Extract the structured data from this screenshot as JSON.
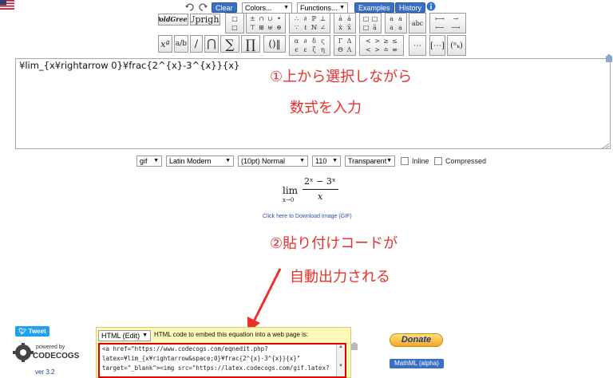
{
  "toolbar": {
    "clear_label": "Clear",
    "colors_select": "Colors...",
    "functions_select": "Functions...",
    "examples_label": "Examples",
    "history_label": "History",
    "boldgreek_label": "𝐁oldGreek",
    "upright_label": "Upright"
  },
  "editor": {
    "content": "¥lim_{x¥rightarrow 0}¥frac{2^{x}-3^{x}}{x}"
  },
  "annotations": {
    "step1_line1": "①上から選択しながら",
    "step1_line2": "数式を入力",
    "step2_line1": "②貼り付けコードが",
    "step2_line2": "自動出力される"
  },
  "options": {
    "format": "gif",
    "font": "Latin Modern",
    "size": "(10pt) Normal",
    "dpi": "110",
    "background": "Transparent",
    "inline_label": "Inline",
    "compressed_label": "Compressed"
  },
  "preview": {
    "lim_word": "lim",
    "lim_sub": "x→0",
    "numerator": "2ˣ − 3ˣ",
    "denominator": "x",
    "download_link": "Click here to Download Image (GIF)"
  },
  "embed": {
    "mode_select": "HTML (Edit)",
    "description": "HTML code to embed this equation into a web page is:",
    "code_line1": "<a href=\"https://www.codecogs.com/eqnedit.php?",
    "code_line2": "latex=¥lim_{x¥rightarrow&space;0}¥frac{2^{x}-3^{x}}{x}\"",
    "code_line3": "target=\"_blank\"><img src=\"https://latex.codecogs.com/gif.latex?"
  },
  "footer": {
    "tweet_label": "Tweet",
    "powered_by": "powered by",
    "brand": "CODECOGS",
    "version": "ver 3.2",
    "donate_label": "Donate",
    "mathml_label": "MathML (alpha)"
  },
  "colors": {
    "annotation_red": "#e8312a",
    "button_blue": "#3a6fc4"
  }
}
